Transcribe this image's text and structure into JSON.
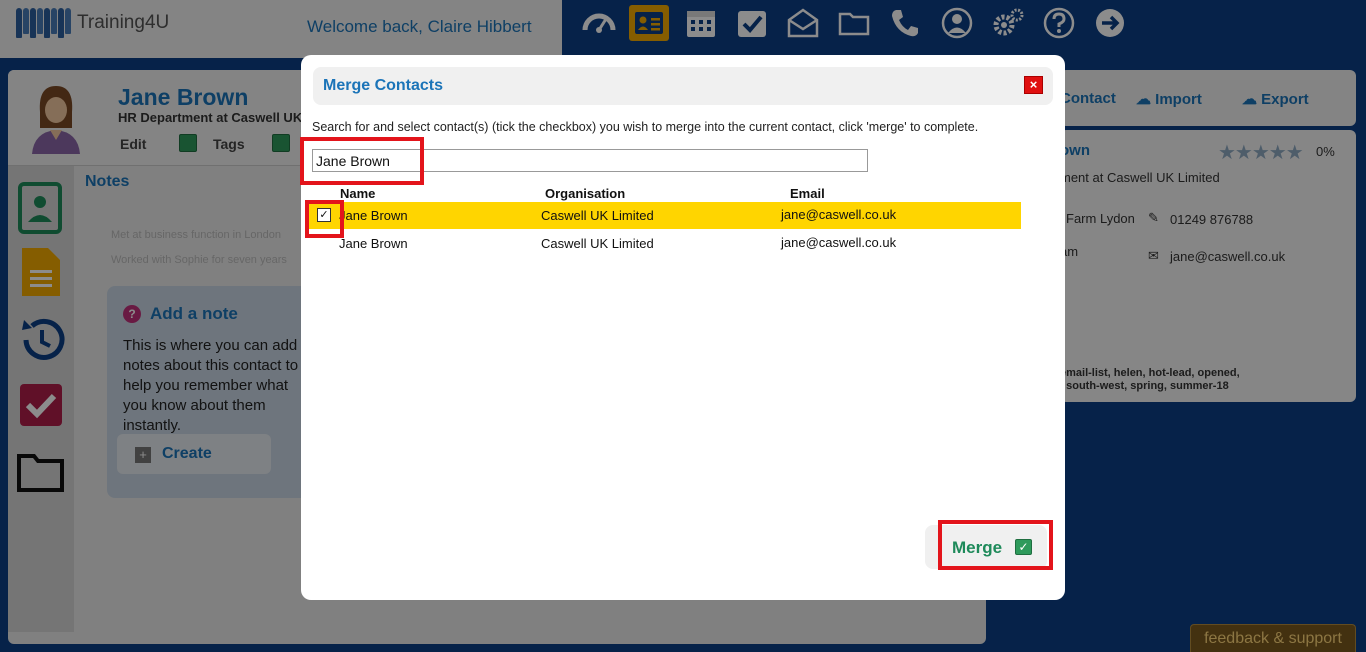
{
  "app": {
    "logo_text": "Training4U",
    "welcome": "Welcome back, Claire Hibbert"
  },
  "nav": {
    "icons": [
      "dashboard-icon",
      "contacts-card-icon",
      "calendar-icon",
      "tasks-check-icon",
      "mail-icon",
      "folder-icon",
      "phone-icon",
      "user-icon",
      "settings-icon",
      "help-icon",
      "logout-arrow-icon"
    ],
    "active": "contacts-card-icon"
  },
  "contact": {
    "name": "Jane Brown",
    "subtitle": "HR Department at Caswell UK Limited",
    "edit_label": "Edit",
    "tags_label": "Tags"
  },
  "notes": {
    "label": "Notes",
    "faded_lines": [
      "Met at business function in London",
      "Worked with Sophie for seven years"
    ],
    "add_note_title": "Add a note",
    "add_note_text": "This is where you can add notes about this contact to help you remember what you know about them instantly.",
    "create_label": "Create"
  },
  "right_panel": {
    "actions": [
      "Contact",
      "Import",
      "Export"
    ],
    "name_fragment": "own",
    "completeness": "0%",
    "org_line": "ment at Caswell UK Limited",
    "address_fragment": "Farm Lydon",
    "phone": "01249 876788",
    "city_fragment": "am",
    "email": "jane@caswell.co.uk",
    "tags_line1": "email-list,   helen,   hot-lead,   opened,",
    "tags_line2": ",   south-west,   spring,   summer-18"
  },
  "feedback_label": "feedback & support",
  "modal": {
    "title": "Merge Contacts",
    "close_symbol": "×",
    "instructions": "Search for and select contact(s) (tick the checkbox) you wish to merge into the current contact, click 'merge' to complete.",
    "search_value": "Jane Brown",
    "columns": {
      "name": "Name",
      "organisation": "Organisation",
      "email": "Email"
    },
    "rows": [
      {
        "checked": true,
        "name": "Jane Brown",
        "organisation": "Caswell UK Limited",
        "email": "jane@caswell.co.uk",
        "selected": true
      },
      {
        "checked": false,
        "name": "Jane Brown",
        "organisation": "Caswell UK Limited",
        "email": "jane@caswell.co.uk",
        "selected": false
      }
    ],
    "merge_label": "Merge"
  },
  "colors": {
    "accent": "#1b74b8",
    "highlight": "#ffd500",
    "annotation_red": "#e3141b",
    "nav_bg": "#0c3f86"
  }
}
